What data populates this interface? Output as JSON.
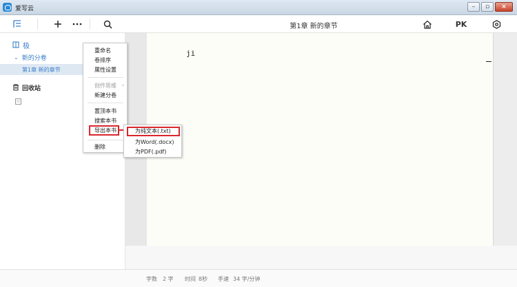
{
  "window": {
    "title": "爱写云"
  },
  "toolbar": {
    "document_title": "第1章  新的章节",
    "pk_label": "PK"
  },
  "sidebar": {
    "volume_label": "极",
    "subvolume_label": "新的分卷",
    "chapter_label": "第1章  新的章节",
    "recycle_label": "回收站"
  },
  "editor": {
    "content": "ji"
  },
  "context_menu": {
    "rename": "重命名",
    "sort_volumes": "卷排序",
    "properties": "属性设置",
    "creative_thinking": "创作思维",
    "new_volume": "新建分卷",
    "pin_book": "置顶本书",
    "search_book": "搜索本书",
    "export_book": "导出本书",
    "delete": "删除"
  },
  "export_submenu": {
    "txt": "为纯文本(.txt)",
    "docx": "为Word(.docx)",
    "pdf": "为PDF(.pdf)"
  },
  "statusbar": {
    "word_count_label": "字数",
    "word_count_value": "2 字",
    "time_label": "时间",
    "time_value": "8秒",
    "speed_label": "手速",
    "speed_value": "34 字/分钟"
  },
  "colors": {
    "accent": "#3a7fc8",
    "highlight_box": "#d9262c",
    "editor_bg": "#fdfdf8"
  },
  "icons": [
    "tree-toggle-icon",
    "add-icon",
    "more-icon",
    "search-icon",
    "home-icon",
    "settings-icon",
    "book-icon",
    "trash-icon",
    "document-icon",
    "red-arrow-icon"
  ]
}
